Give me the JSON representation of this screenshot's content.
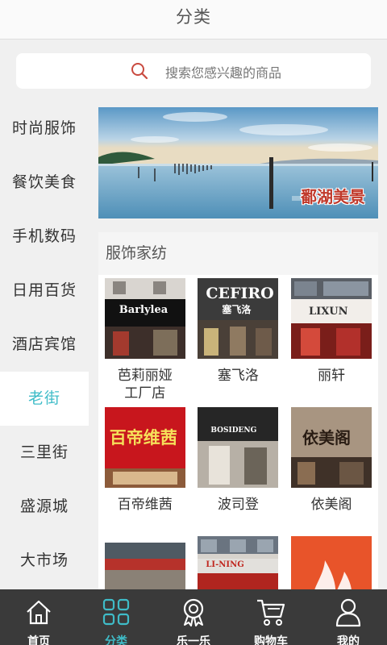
{
  "header": {
    "title": "分类"
  },
  "search": {
    "placeholder": "搜索您感兴趣的商品"
  },
  "sidebar": {
    "items": [
      {
        "label": "时尚服饰"
      },
      {
        "label": "餐饮美食"
      },
      {
        "label": "手机数码"
      },
      {
        "label": "日用百货"
      },
      {
        "label": "酒店宾馆"
      },
      {
        "label": "老街",
        "active": true
      },
      {
        "label": "三里街"
      },
      {
        "label": "盛源城"
      },
      {
        "label": "大市场"
      }
    ]
  },
  "banner": {
    "caption": "鄱湖美景"
  },
  "section": {
    "title": "服饰家纺"
  },
  "shops": [
    {
      "name": "芭莉丽娅\n工厂店",
      "sign": "Barlylea"
    },
    {
      "name": "塞飞洛",
      "sign": "CEFIRO",
      "sign2": "塞飞洛"
    },
    {
      "name": "丽轩",
      "sign": "LIXUN"
    },
    {
      "name": "百帝维茜",
      "sign": "百帝维茜"
    },
    {
      "name": "波司登",
      "sign": "BOSIDENG"
    },
    {
      "name": "依美阁",
      "sign": "依美阁"
    },
    {
      "name": "",
      "sign": ""
    },
    {
      "name": "",
      "sign": "LI-NING"
    },
    {
      "name": "",
      "sign": ""
    }
  ],
  "tabs": [
    {
      "label": "首页",
      "icon": "home-icon"
    },
    {
      "label": "分类",
      "icon": "grid-icon",
      "active": true
    },
    {
      "label": "乐一乐",
      "icon": "medal-icon"
    },
    {
      "label": "购物车",
      "icon": "cart-icon"
    },
    {
      "label": "我的",
      "icon": "user-icon"
    }
  ],
  "colors": {
    "accent": "#3fbcc8",
    "tabbar": "#3a3a3a",
    "search_icon": "#c94a3f"
  }
}
